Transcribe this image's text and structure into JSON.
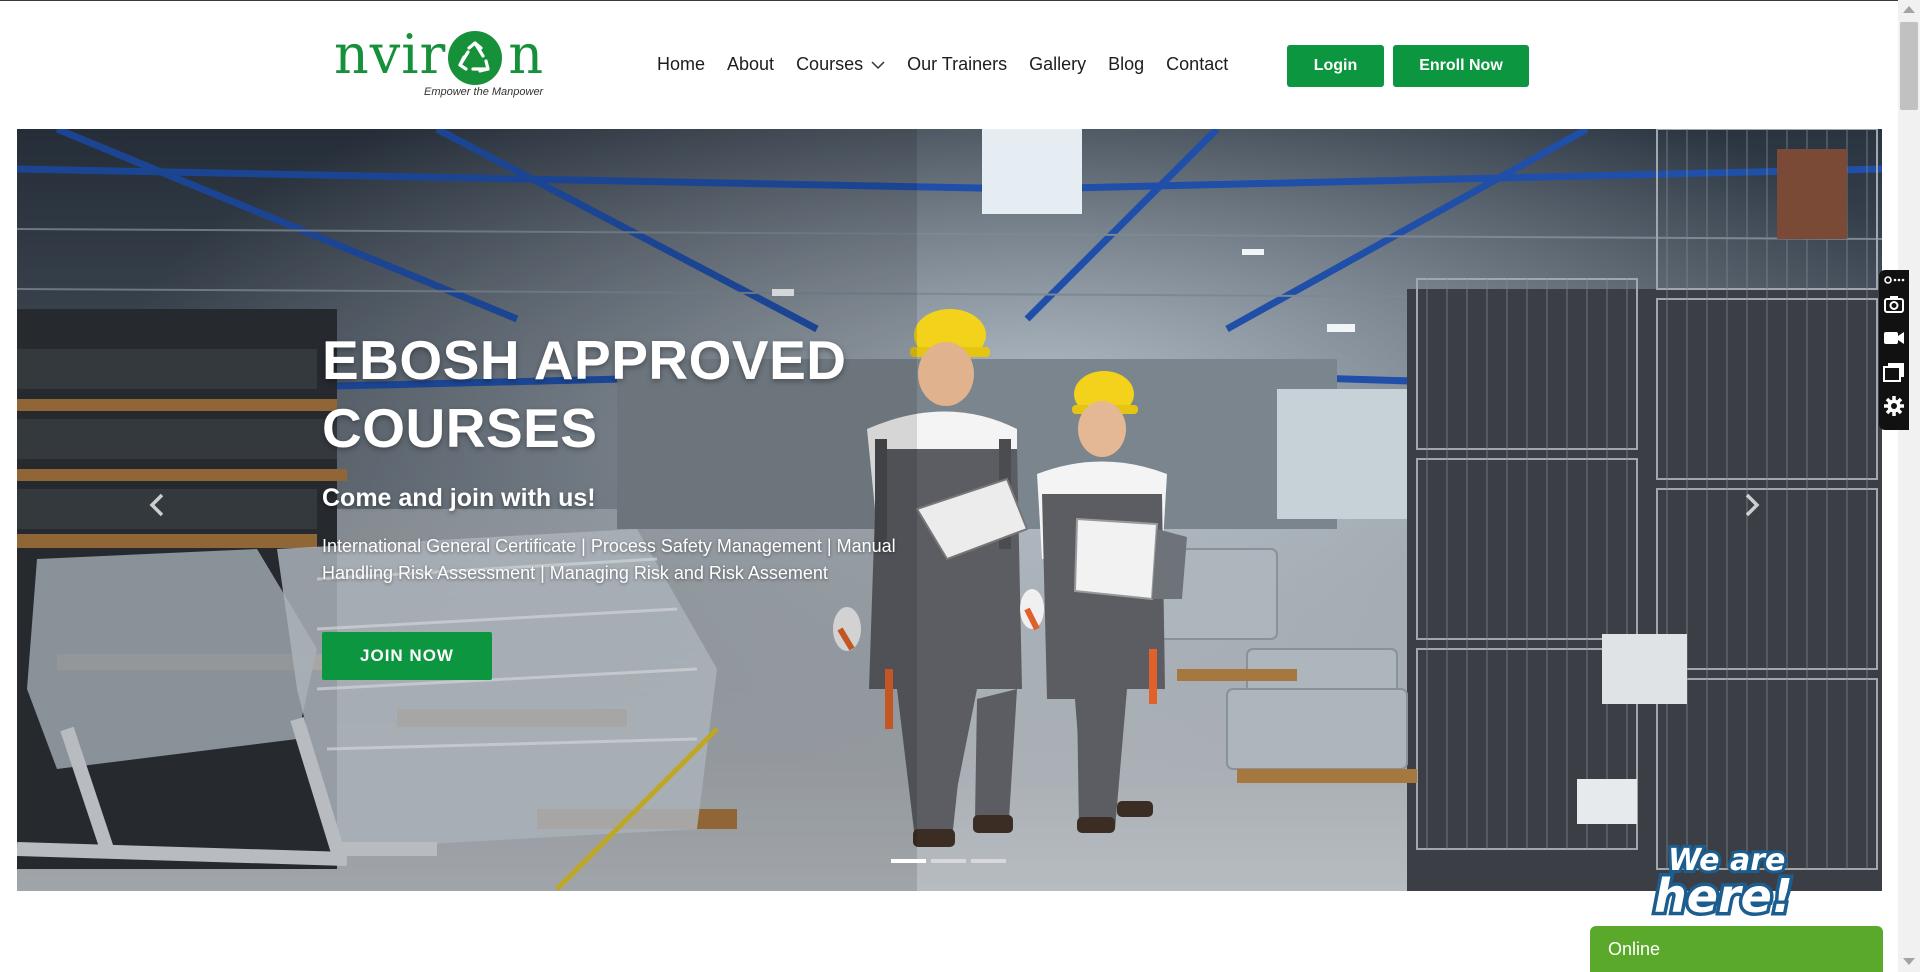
{
  "brand": {
    "logo_word_left": "nvir",
    "logo_word_right": "n",
    "tagline": "Empower the Manpower",
    "color": "#17903a"
  },
  "nav": {
    "items": [
      {
        "label": "Home"
      },
      {
        "label": "About"
      },
      {
        "label": "Courses",
        "has_dropdown": true
      },
      {
        "label": "Our Trainers"
      },
      {
        "label": "Gallery"
      },
      {
        "label": "Blog"
      },
      {
        "label": "Contact"
      }
    ],
    "login_label": "Login",
    "enroll_label": "Enroll Now",
    "accent": "#0d9640"
  },
  "hero": {
    "title_line1": "EBOSH APPROVED",
    "title_line2": "COURSES",
    "subtitle": "Come and join with us!",
    "description": "International General Certificate | Process Safety Management | Manual Handling Risk Assessment | Managing Risk and Risk Assement",
    "cta_label": "JOIN NOW",
    "prev_icon": "chevron-left-icon",
    "next_icon": "chevron-right-icon",
    "slide_count": 3,
    "active_slide": 1
  },
  "widgets": {
    "tools": [
      "link-icon",
      "camera-icon",
      "video-icon",
      "window-icon",
      "settings-icon"
    ],
    "badge_text_line1": "We are",
    "badge_text_line2": "here!",
    "chat_label": "Online",
    "chat_color": "#5aa92a"
  }
}
